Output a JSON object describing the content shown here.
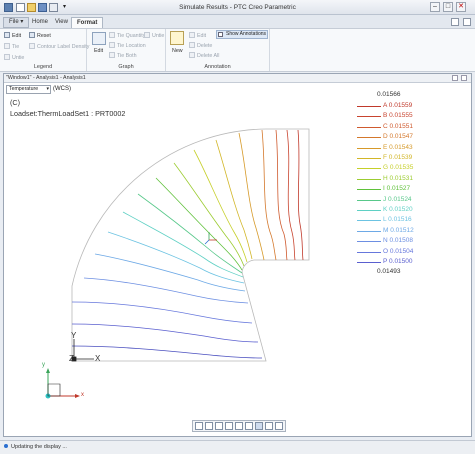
{
  "window": {
    "title": "Simulate Results - PTC Creo Parametric"
  },
  "tabs": [
    {
      "label": "File ▾"
    },
    {
      "label": "Home"
    },
    {
      "label": "View"
    },
    {
      "label": "Format"
    }
  ],
  "ribbon": {
    "legend_group": {
      "label": "Legend",
      "edit": "Edit",
      "reset": "Reset",
      "tie": "Tie",
      "untie": "Untie",
      "contour_density": "Contour Label Density"
    },
    "graph_group": {
      "label": "Graph",
      "edit": "Edit",
      "tie_quantity": "Tie Quantity",
      "tie_location": "Tie Location",
      "tie_both": "Tie Both",
      "untie": "Untie"
    },
    "annotation_group": {
      "label": "Annotation",
      "new": "New",
      "edit": "Edit",
      "delete": "Delete",
      "delete_all": "Delete All",
      "show_annotations": "Show Annotations"
    }
  },
  "document": {
    "title": "\"Window1\" - Analysis1 - Analysis1",
    "quantity": "Temperature",
    "coord_system": "(WCS)",
    "view_label": "(C)",
    "loadset_label": "Loadset:ThermLoadSet1 :  PRT0002",
    "axis_labels": {
      "y": "Y",
      "z": "Z",
      "x": "X",
      "mini_x": "x",
      "mini_y": "y"
    }
  },
  "legend": {
    "max": "0.01566",
    "min": "0.01493",
    "entries": [
      {
        "label": "A 0.01559",
        "color": "#c0392b"
      },
      {
        "label": "B 0.01555",
        "color": "#c8442f"
      },
      {
        "label": "C 0.01551",
        "color": "#cf5a2e"
      },
      {
        "label": "D 0.01547",
        "color": "#d4782c"
      },
      {
        "label": "E 0.01543",
        "color": "#d69a2a"
      },
      {
        "label": "F 0.01539",
        "color": "#d2b628"
      },
      {
        "label": "G 0.01535",
        "color": "#c6cf2a"
      },
      {
        "label": "H 0.01531",
        "color": "#9ccc31"
      },
      {
        "label": "I  0.01527",
        "color": "#5fc13a"
      },
      {
        "label": "J 0.01524",
        "color": "#58c88a"
      },
      {
        "label": "K 0.01520",
        "color": "#5fd0c4"
      },
      {
        "label": "L 0.01516",
        "color": "#6cc3e2"
      },
      {
        "label": "M 0.01512",
        "color": "#6ea9e6"
      },
      {
        "label": "N 0.01508",
        "color": "#6d8fe2"
      },
      {
        "label": "O 0.01504",
        "color": "#6677dc"
      },
      {
        "label": "P 0.01500",
        "color": "#5a5fcf"
      }
    ]
  },
  "status": {
    "message": "Updating the display ..."
  }
}
